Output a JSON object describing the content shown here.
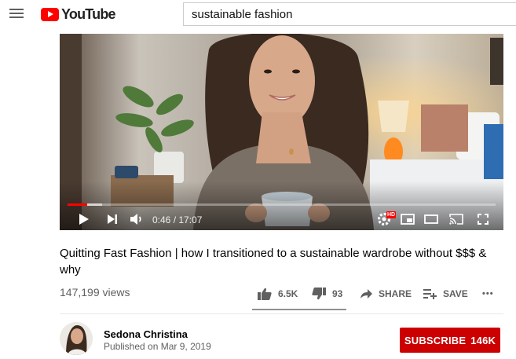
{
  "app": {
    "name": "YouTube",
    "brand_color": "#ff0000"
  },
  "masthead": {
    "logo_text": "YouTube",
    "search_value": "sustainable fashion"
  },
  "player": {
    "time_current": "0:46",
    "time_total": "17:07",
    "time_display": "0:46 / 17:07",
    "progress_played_fraction": 0.045,
    "progress_loaded_fraction": 0.08,
    "hd_badge": "HD",
    "icons": [
      "play-icon",
      "next-icon",
      "volume-icon",
      "settings-icon",
      "miniplayer-icon",
      "theater-icon",
      "cast-icon",
      "fullscreen-icon"
    ]
  },
  "video": {
    "title": "Quitting Fast Fashion | how I transitioned to a sustainable wardrobe without $$$ & why",
    "views": "147,199 views",
    "likes": "6.5K",
    "dislikes": "93",
    "share_label": "SHARE",
    "save_label": "SAVE",
    "more_label": "•••",
    "like_ratio": 0.986
  },
  "channel": {
    "name": "Sedona Christina",
    "published": "Published on Mar 9, 2019",
    "subscribe_label": "SUBSCRIBE",
    "subscriber_count": "146K",
    "subscribe_color": "#cc0000"
  }
}
